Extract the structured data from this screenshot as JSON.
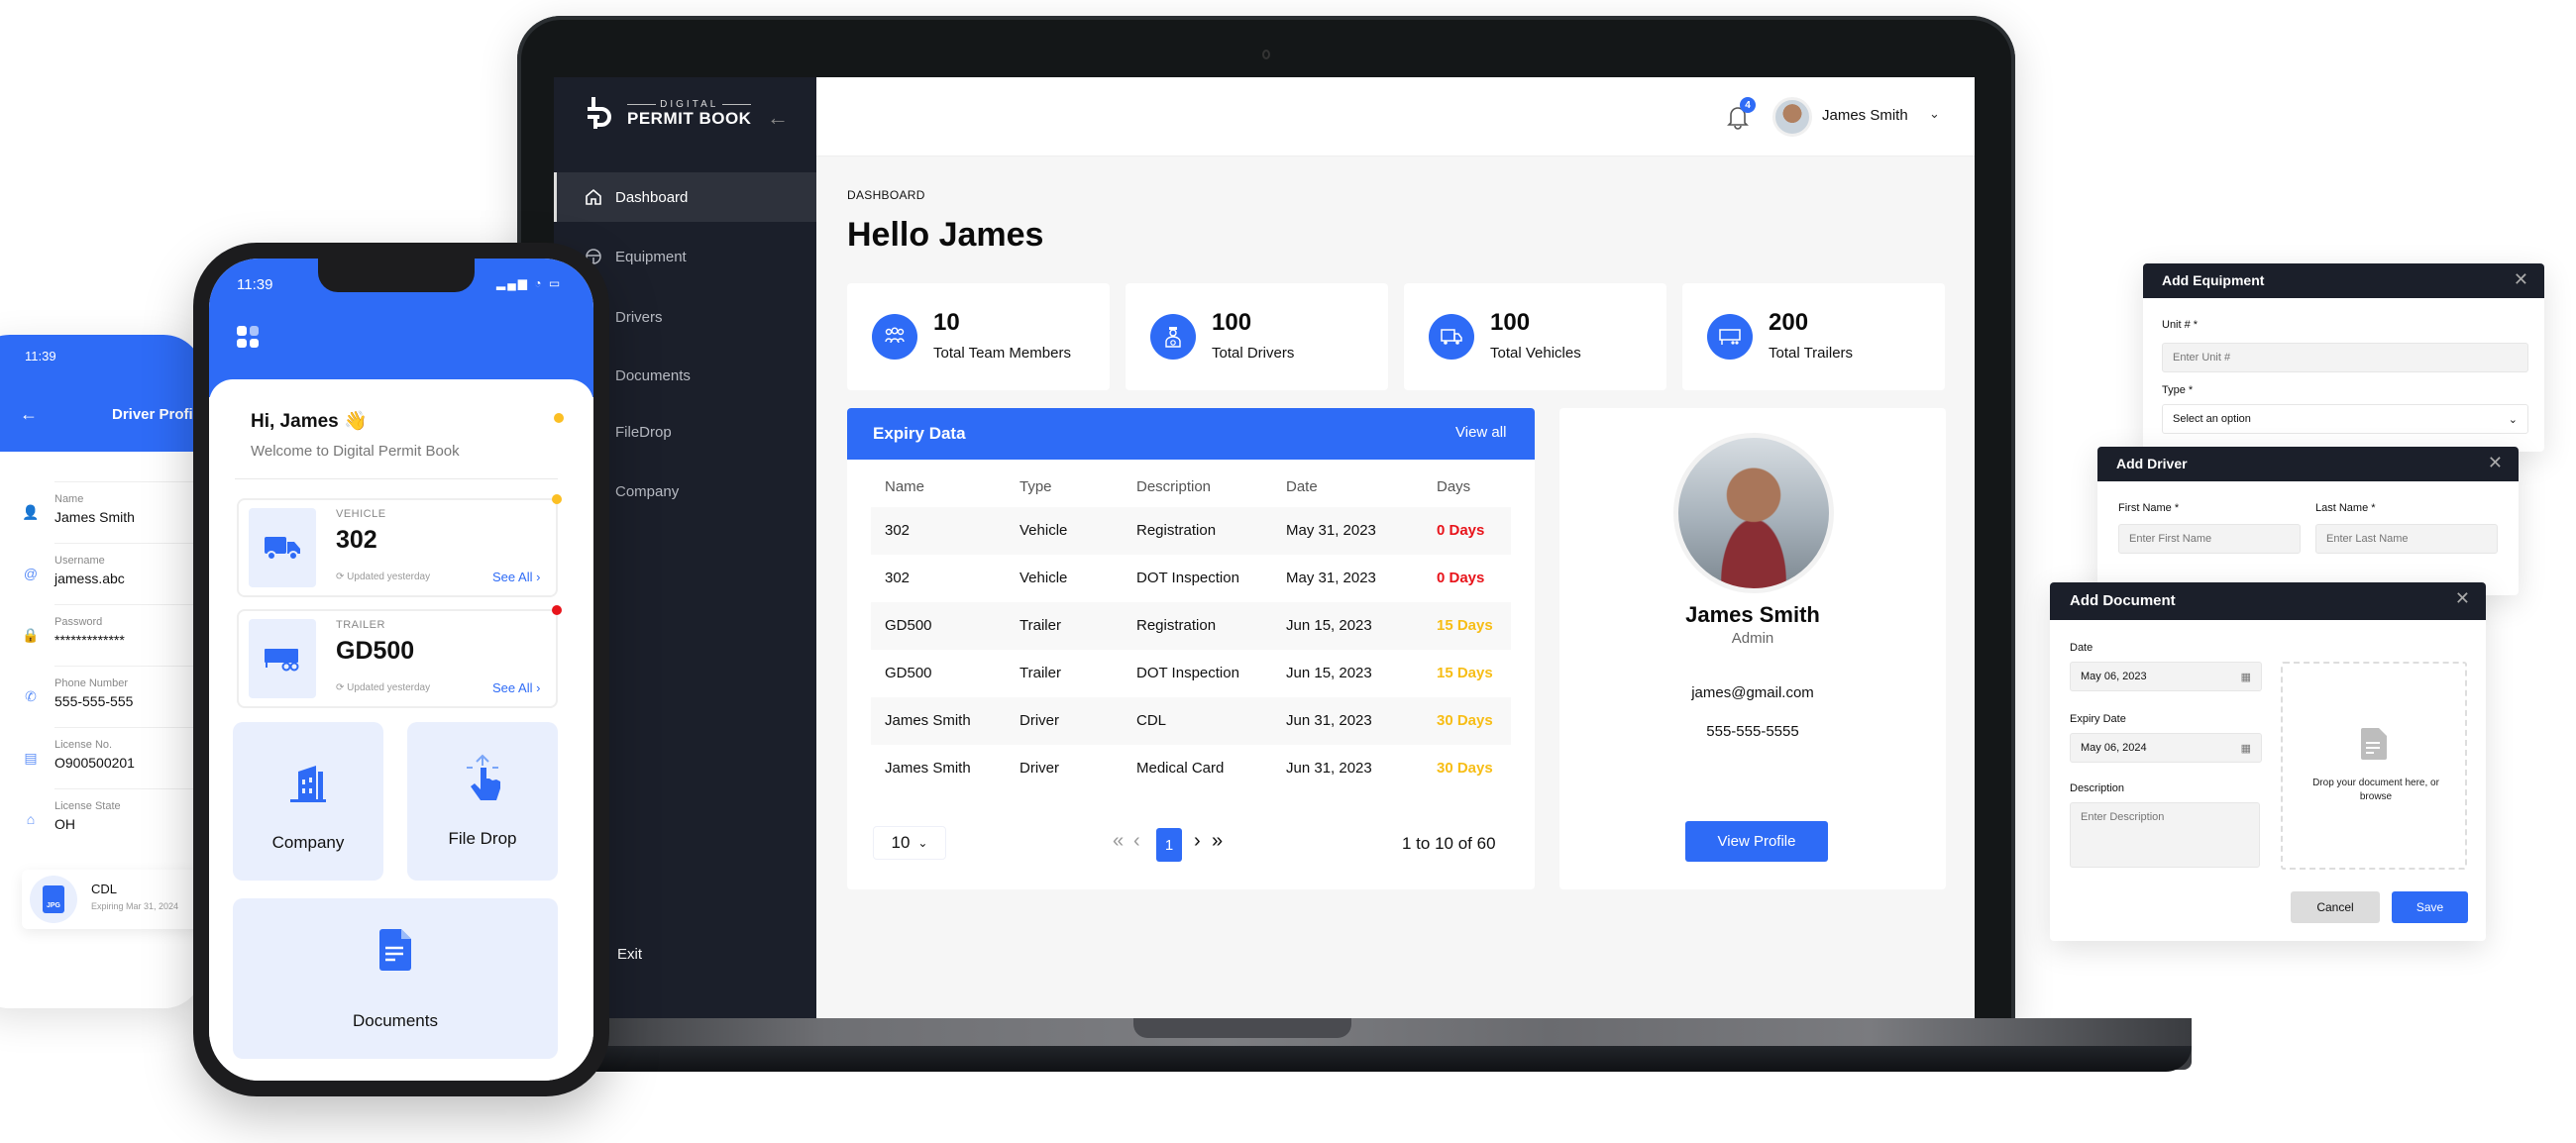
{
  "laptop": {
    "brand": {
      "small": "DIGITAL",
      "big": "PERMIT BOOK"
    },
    "sidebar": {
      "items": [
        {
          "label": "Dashboard",
          "icon": "home-icon",
          "active": true
        },
        {
          "label": "Equipment",
          "icon": "steering-wheel-icon"
        },
        {
          "label": "Drivers"
        },
        {
          "label": "Documents"
        },
        {
          "label": "FileDrop"
        },
        {
          "label": "Company"
        }
      ],
      "exit_label": "Exit"
    },
    "topbar": {
      "notifications": "4",
      "user_name": "James Smith"
    },
    "breadcrumb": "DASHBOARD",
    "title": "Hello James",
    "stats": [
      {
        "value": "10",
        "label": "Total Team Members",
        "icon": "team-icon"
      },
      {
        "value": "100",
        "label": "Total Drivers",
        "icon": "driver-icon"
      },
      {
        "value": "100",
        "label": "Total Vehicles",
        "icon": "truck-icon"
      },
      {
        "value": "200",
        "label": "Total Trailers",
        "icon": "trailer-icon"
      }
    ],
    "expiry": {
      "title": "Expiry Data",
      "view_all": "View all",
      "columns": [
        "Name",
        "Type",
        "Description",
        "Date",
        "Days"
      ],
      "rows": [
        {
          "name": "302",
          "type": "Vehicle",
          "description": "Registration",
          "date": "May 31, 2023",
          "days": "0 Days",
          "status": "expired"
        },
        {
          "name": "302",
          "type": "Vehicle",
          "description": "DOT Inspection",
          "date": "May 31, 2023",
          "days": "0 Days",
          "status": "expired"
        },
        {
          "name": "GD500",
          "type": "Trailer",
          "description": "Registration",
          "date": "Jun 15, 2023",
          "days": "15 Days",
          "status": "warning"
        },
        {
          "name": "GD500",
          "type": "Trailer",
          "description": "DOT Inspection",
          "date": "Jun 15, 2023",
          "days": "15 Days",
          "status": "warning"
        },
        {
          "name": "James Smith",
          "type": "Driver",
          "description": "CDL",
          "date": "Jun 31, 2023",
          "days": "30 Days",
          "status": "warning"
        },
        {
          "name": "James Smith",
          "type": "Driver",
          "description": "Medical Card",
          "date": "Jun 31, 2023",
          "days": "30 Days",
          "status": "warning"
        }
      ],
      "page_size": "10",
      "current_page": "1",
      "summary": "1 to 10 of 60"
    },
    "profile": {
      "name": "James Smith",
      "role": "Admin",
      "email": "james@gmail.com",
      "phone": "555-555-5555",
      "button": "View Profile"
    }
  },
  "colors": {
    "accent": "#2e6bf6",
    "expired": "#e8141b",
    "warning": "#f7bd15",
    "sidebar": "#1b1f2a"
  },
  "phone": {
    "time": "11:39",
    "greeting": "Hi, James 👋",
    "welcome": "Welcome to Digital Permit Book",
    "assets": [
      {
        "type": "VEHICLE",
        "name": "302",
        "updated": "Updated yesterday",
        "link": "See All ›",
        "dot": "#fbbf24"
      },
      {
        "type": "TRAILER",
        "name": "GD500",
        "updated": "Updated yesterday",
        "link": "See All ›",
        "dot": "#e8141b"
      }
    ],
    "tiles": [
      {
        "label": "Company",
        "icon": "building-icon"
      },
      {
        "label": "File Drop",
        "icon": "hand-tap-icon"
      },
      {
        "label": "Documents",
        "icon": "document-icon"
      }
    ]
  },
  "driver_profile": {
    "time": "11:39",
    "title": "Driver Profile",
    "fields": [
      {
        "label": "Name",
        "value": "James Smith",
        "icon": "user-icon"
      },
      {
        "label": "Username",
        "value": "jamess.abc",
        "icon": "at-icon"
      },
      {
        "label": "Password",
        "value": "*************",
        "icon": "lock-icon"
      },
      {
        "label": "Phone Number",
        "value": "555-555-555",
        "icon": "phone-icon"
      },
      {
        "label": "License No.",
        "value": "O900500201",
        "icon": "id-card-icon"
      },
      {
        "label": "License State",
        "value": "OH",
        "icon": "map-icon"
      }
    ],
    "document": {
      "name": "CDL",
      "expiry": "Expiring Mar 31, 2024",
      "badge": "JPG"
    }
  },
  "modals": {
    "equipment": {
      "title": "Add Equipment",
      "unit_label": "Unit # *",
      "unit_placeholder": "Enter Unit #",
      "type_label": "Type *",
      "type_value": "Select an option"
    },
    "driver": {
      "title": "Add Driver",
      "first_label": "First Name *",
      "first_placeholder": "Enter First Name",
      "last_label": "Last Name *",
      "last_placeholder": "Enter Last Name"
    },
    "document": {
      "title": "Add Document",
      "date_label": "Date",
      "date_value": "May 06, 2023",
      "expiry_label": "Expiry Date",
      "expiry_value": "May 06, 2024",
      "desc_label": "Description",
      "desc_placeholder": "Enter Description",
      "drop_text": "Drop your document here, or browse",
      "cancel": "Cancel",
      "save": "Save"
    }
  }
}
